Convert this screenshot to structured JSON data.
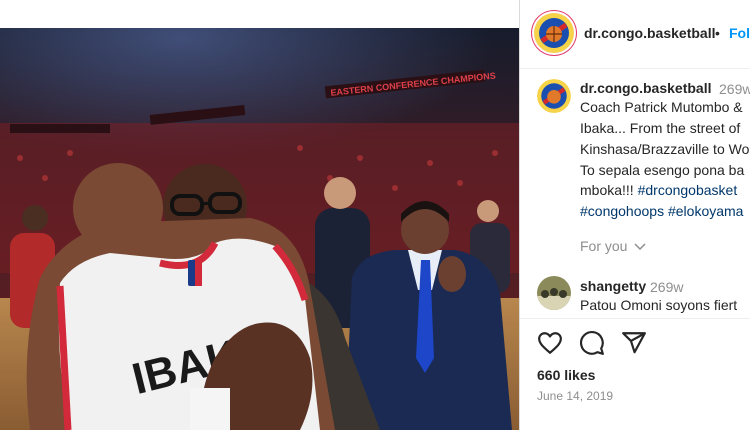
{
  "post": {
    "image_alt": "Photo of Serge Ibaka hugging Coach Patrick Mutombo on the court",
    "jersey_text": "IBAKA",
    "banner_text": "EASTERN CONFERENCE CHAMPIONS"
  },
  "header": {
    "username": "dr.congo.basketball",
    "dot": "•",
    "follow_label": "Fol",
    "avatar_icon": "dr-congo-basketball-logo-icon"
  },
  "caption": {
    "username": "dr.congo.basketball",
    "time": "269w",
    "lines": [
      "Coach Patrick Mutombo &",
      "Ibaka... From the street of",
      "Kinshasa/Brazzaville to Wo",
      "To sepala esengo pona ba"
    ],
    "line5_text": "mboka!!! ",
    "line5_tag": "#drcongobasket",
    "line6_tag1": "#congohoops",
    "line6_sep": " ",
    "line6_tag2": "#elokoyama",
    "for_you": "For you"
  },
  "comment": {
    "username": "shangetty",
    "time": "269w",
    "text": "Patou Omoni soyons fiert"
  },
  "actions": {
    "like_icon": "heart-icon",
    "comment_icon": "comment-icon",
    "share_icon": "send-icon"
  },
  "likes": "660 likes",
  "date": "June 14, 2019",
  "colors": {
    "link": "#00376b",
    "follow": "#0095f6",
    "muted": "#8e8e8e",
    "text": "#262626"
  }
}
